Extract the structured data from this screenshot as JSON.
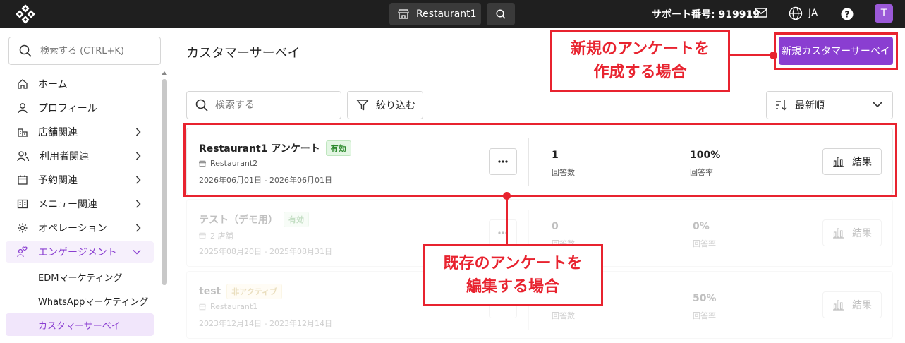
{
  "topbar": {
    "store_name": "Restaurant1",
    "support_label": "サポート番号: 919919",
    "language": "JA",
    "avatar_initial": "T"
  },
  "sidebar": {
    "search_placeholder": "検索する (CTRL+K)",
    "items": [
      {
        "label": "ホーム",
        "icon": "home-icon"
      },
      {
        "label": "プロフィール",
        "icon": "user-icon"
      },
      {
        "label": "店舗関連",
        "icon": "store-icon"
      },
      {
        "label": "利用者関連",
        "icon": "users-icon"
      },
      {
        "label": "予約関連",
        "icon": "calendar-icon"
      },
      {
        "label": "メニュー関連",
        "icon": "menu-book-icon"
      },
      {
        "label": "オペレーション",
        "icon": "cog-icon"
      },
      {
        "label": "エンゲージメント",
        "icon": "engagement-icon"
      }
    ],
    "sub_items": [
      {
        "label": "EDMマーケティング"
      },
      {
        "label": "WhatsAppマーケティング"
      },
      {
        "label": "カスタマーサーベイ"
      }
    ]
  },
  "main": {
    "title": "カスタマーサーベイ",
    "new_button": "新規カスタマーサーベイ",
    "search_placeholder": "検索する",
    "filter_label": "絞り込む",
    "sort_label": "最新順",
    "surveys": [
      {
        "name": "Restaurant1 アンケート",
        "status": "有効",
        "store": "Restaurant2",
        "period": "2026年06月01日 - 2026年06月01日",
        "responses": "1",
        "responses_label": "回答数",
        "rate": "100%",
        "rate_label": "回答率",
        "result_label": "結果"
      },
      {
        "name": "テスト（デモ用）",
        "status": "有効",
        "store": "2 店舗",
        "period": "2025年08月20日 - 2025年08月31日",
        "responses": "0",
        "responses_label": "回答数",
        "rate": "0%",
        "rate_label": "回答率",
        "result_label": "結果"
      },
      {
        "name": "test",
        "status": "非アクティブ",
        "store": "Restaurant1",
        "period": "2023年12月14日 - 2023年12月14日",
        "responses": "",
        "responses_label": "回答数",
        "rate": "50%",
        "rate_label": "回答率",
        "result_label": "結果"
      }
    ]
  },
  "annotations": {
    "create_line1": "新規のアンケートを",
    "create_line2": "作成する場合",
    "edit_line1": "既存のアンケートを",
    "edit_line2": "編集する場合"
  },
  "colors": {
    "accent": "#8a3ed1",
    "annotation": "#e8232f",
    "topbar": "#1f1f1f"
  }
}
